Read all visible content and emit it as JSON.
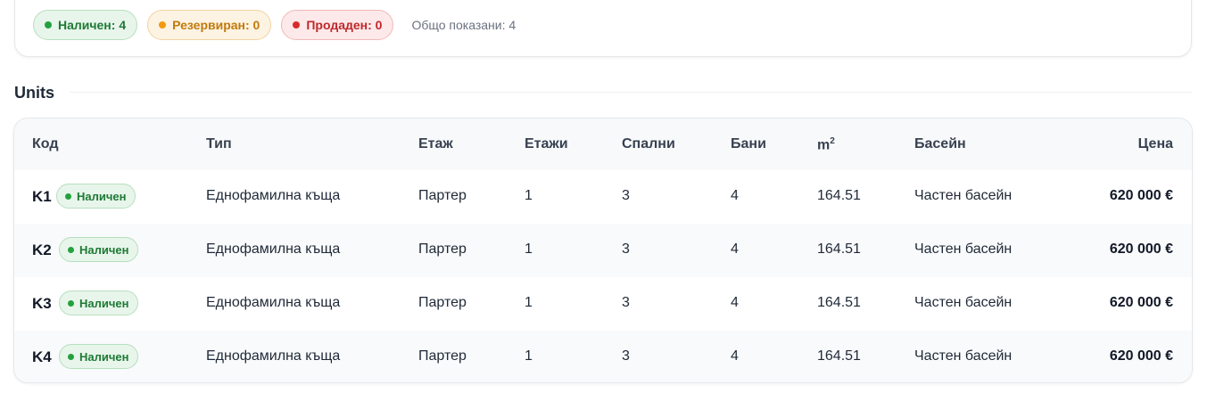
{
  "status_summary": {
    "available_label": "Наличен: 4",
    "reserved_label": "Резервиран: 0",
    "sold_label": "Продаден: 0",
    "total_shown": "Общо показани: 4",
    "colors": {
      "available": "#22a23d",
      "reserved": "#f29a0e",
      "sold": "#d92b2b"
    }
  },
  "units_section": {
    "title": "Units",
    "columns": {
      "code": "Код",
      "type": "Тип",
      "floor": "Етаж",
      "floors": "Етажи",
      "bedrooms": "Спални",
      "bathrooms": "Бани",
      "area": "m",
      "area_sup": "2",
      "pool": "Басейн",
      "price": "Цена"
    },
    "rows": [
      {
        "code": "K1",
        "status": "Наличен",
        "type": "Еднофамилна къща",
        "floor": "Партер",
        "floors": "1",
        "bedrooms": "3",
        "bathrooms": "4",
        "area": "164.51",
        "pool": "Частен басейн",
        "price": "620 000 €"
      },
      {
        "code": "K2",
        "status": "Наличен",
        "type": "Еднофамилна къща",
        "floor": "Партер",
        "floors": "1",
        "bedrooms": "3",
        "bathrooms": "4",
        "area": "164.51",
        "pool": "Частен басейн",
        "price": "620 000 €"
      },
      {
        "code": "K3",
        "status": "Наличен",
        "type": "Еднофамилна къща",
        "floor": "Партер",
        "floors": "1",
        "bedrooms": "3",
        "bathrooms": "4",
        "area": "164.51",
        "pool": "Частен басейн",
        "price": "620 000 €"
      },
      {
        "code": "K4",
        "status": "Наличен",
        "type": "Еднофамилна къща",
        "floor": "Партер",
        "floors": "1",
        "bedrooms": "3",
        "bathrooms": "4",
        "area": "164.51",
        "pool": "Частен басейн",
        "price": "620 000 €"
      }
    ]
  }
}
